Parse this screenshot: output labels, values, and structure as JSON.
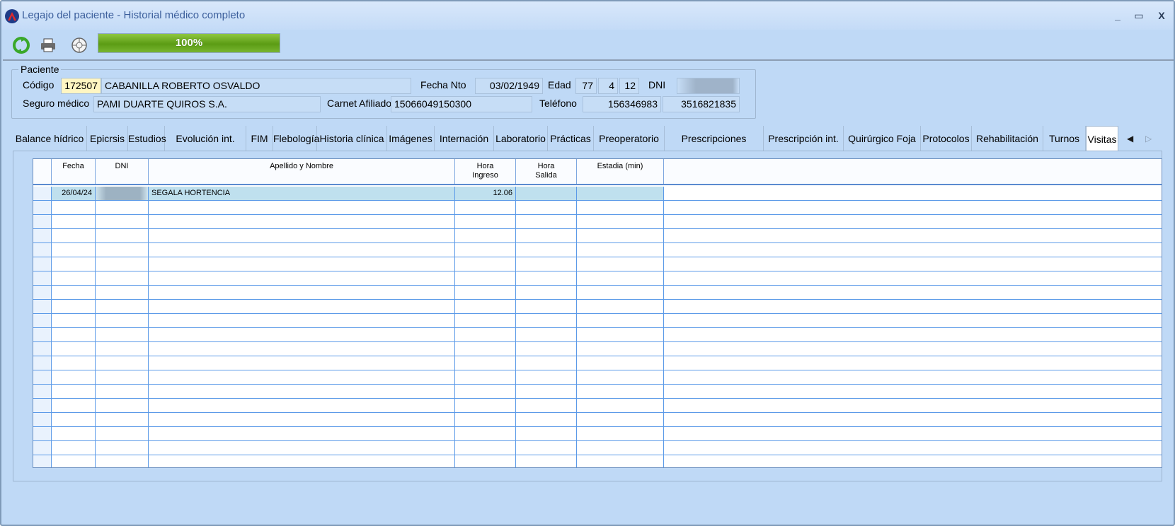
{
  "window": {
    "title": "Legajo del paciente - Historial médico completo",
    "min_glyph": "_",
    "max_glyph": "▭",
    "close_glyph": "X",
    "icon": "app-logo-icon"
  },
  "toolbar": {
    "refresh_icon": "refresh-icon",
    "print_icon": "printer-icon",
    "help_icon": "help-icon",
    "progress_value": 1.0,
    "progress_text": "100%"
  },
  "paciente": {
    "legend": "Paciente",
    "codigo_label": "Código",
    "codigo": "172507",
    "nombre": "CABANILLA ROBERTO OSVALDO",
    "fecha_nto_label": "Fecha Nto",
    "fecha_nto": "03/02/1949",
    "edad_label": "Edad",
    "edad_anios": "77",
    "edad_meses": "4",
    "edad_dias": "12",
    "dni_label": "DNI",
    "dni": "",
    "seguro_label": "Seguro médico",
    "seguro": "PAMI DUARTE QUIROS S.A.",
    "carnet_label": "Carnet Afiliado",
    "carnet": "15066049150300",
    "telefono_label": "Teléfono",
    "telefono1": "156346983",
    "telefono2": "3516821835"
  },
  "tabs": [
    {
      "label": "Balance hídrico"
    },
    {
      "label": "Epicrsis"
    },
    {
      "label": "Estudios"
    },
    {
      "label": "Evolución int."
    },
    {
      "label": "FIM"
    },
    {
      "label": "Flebología"
    },
    {
      "label": "Historia clínica"
    },
    {
      "label": "Imágenes"
    },
    {
      "label": "Internación"
    },
    {
      "label": "Laboratorio"
    },
    {
      "label": "Prácticas"
    },
    {
      "label": "Preoperatorio"
    },
    {
      "label": "Prescripciones"
    },
    {
      "label": "Prescripción int."
    },
    {
      "label": "Quirúrgico Foja"
    },
    {
      "label": "Protocolos"
    },
    {
      "label": "Rehabilitación"
    },
    {
      "label": "Turnos"
    },
    {
      "label": "Visitas"
    }
  ],
  "active_tab": "Visitas",
  "tab_scroll": {
    "left": "◀",
    "right": "▷"
  },
  "grid": {
    "headers": {
      "fecha": "Fecha",
      "dni": "DNI",
      "nombre": "Apellido y Nombre",
      "hora_ingreso_1": "Hora",
      "hora_ingreso_2": "Ingreso",
      "hora_salida_1": "Hora",
      "hora_salida_2": "Salida",
      "estadia": "Estadia (min)"
    },
    "rows": [
      {
        "fecha": "26/04/24",
        "dni": "",
        "nombre": "SEGALA HORTENCIA",
        "hora_ingreso": "12.06",
        "hora_salida": "",
        "estadia": ""
      }
    ],
    "empty_rows": 19
  }
}
